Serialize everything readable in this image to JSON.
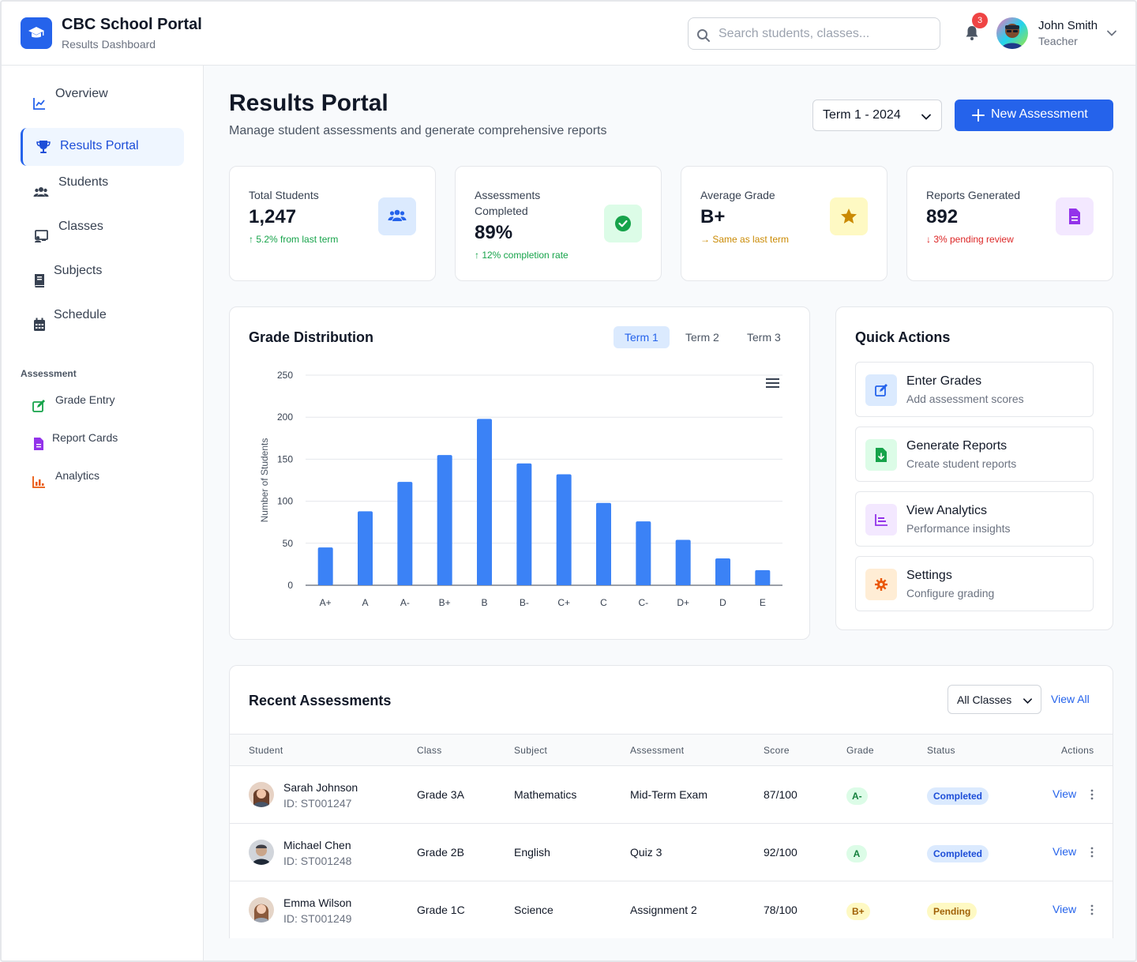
{
  "header": {
    "app_title": "CBC School Portal",
    "app_subtitle": "Results Dashboard",
    "search_placeholder": "Search students, classes...",
    "notification_count": "3",
    "user_name": "John Smith",
    "user_role": "Teacher"
  },
  "sidebar": {
    "items": [
      {
        "label": "Overview",
        "icon": "chart-line-icon"
      },
      {
        "label": "Results Portal",
        "icon": "trophy-icon",
        "active": true
      },
      {
        "label": "Students",
        "icon": "users-icon"
      },
      {
        "label": "Classes",
        "icon": "chalkboard-icon"
      },
      {
        "label": "Subjects",
        "icon": "book-icon"
      },
      {
        "label": "Schedule",
        "icon": "calendar-icon"
      }
    ],
    "section_label": "Assessment",
    "sub_items": [
      {
        "label": "Grade Entry",
        "icon": "edit-icon",
        "color": "#16a34a"
      },
      {
        "label": "Report Cards",
        "icon": "file-icon",
        "color": "#9333ea"
      },
      {
        "label": "Analytics",
        "icon": "bar-chart-icon",
        "color": "#ea580c"
      }
    ]
  },
  "page": {
    "title": "Results Portal",
    "subtitle": "Manage student assessments and generate comprehensive reports",
    "term_selected": "Term 1 - 2024",
    "new_button": "New Assessment"
  },
  "stats": [
    {
      "label": "Total Students",
      "value": "1,247",
      "note": "↑ 5.2% from last term",
      "note_color": "#16a34a",
      "icon": "users-icon",
      "icon_bg": "#dbeafe",
      "icon_color": "#2563eb"
    },
    {
      "label": "Assessments Completed",
      "value": "89%",
      "note": "↑ 12% completion rate",
      "note_color": "#16a34a",
      "icon": "check-circle-icon",
      "icon_bg": "#dcfce7",
      "icon_color": "#16a34a"
    },
    {
      "label": "Average Grade",
      "value": "B+",
      "note": "→ Same as last term",
      "note_color": "#ca8a04",
      "icon": "star-icon",
      "icon_bg": "#fef9c3",
      "icon_color": "#ca8a04"
    },
    {
      "label": "Reports Generated",
      "value": "892",
      "note": "↓ 3% pending review",
      "note_color": "#dc2626",
      "icon": "file-icon",
      "icon_bg": "#f3e8ff",
      "icon_color": "#9333ea"
    }
  ],
  "grade_distribution": {
    "title": "Grade Distribution",
    "tabs": [
      "Term 1",
      "Term 2",
      "Term 3"
    ],
    "active_tab": "Term 1"
  },
  "chart_data": {
    "type": "bar",
    "categories": [
      "A+",
      "A",
      "A-",
      "B+",
      "B",
      "B-",
      "C+",
      "C",
      "C-",
      "D+",
      "D",
      "E"
    ],
    "values": [
      45,
      88,
      123,
      155,
      198,
      145,
      132,
      98,
      76,
      54,
      32,
      18
    ],
    "xlabel": "",
    "ylabel": "Number of Students",
    "ylim": [
      0,
      250
    ],
    "yticks": [
      0,
      50,
      100,
      150,
      200,
      250
    ],
    "color": "#3b82f6",
    "grid": true
  },
  "quick_actions": {
    "title": "Quick Actions",
    "items": [
      {
        "name": "Enter Grades",
        "desc": "Add assessment scores",
        "icon": "edit-icon",
        "bg": "#dbeafe",
        "color": "#2563eb"
      },
      {
        "name": "Generate Reports",
        "desc": "Create student reports",
        "icon": "file-download-icon",
        "bg": "#dcfce7",
        "color": "#16a34a"
      },
      {
        "name": "View Analytics",
        "desc": "Performance insights",
        "icon": "bar-chart-icon",
        "bg": "#f3e8ff",
        "color": "#9333ea"
      },
      {
        "name": "Settings",
        "desc": "Configure grading",
        "icon": "gear-icon",
        "bg": "#ffedd5",
        "color": "#ea580c"
      }
    ]
  },
  "recent": {
    "title": "Recent Assessments",
    "filter": "All Classes",
    "view_all": "View All",
    "columns": [
      "Student",
      "Class",
      "Subject",
      "Assessment",
      "Score",
      "Grade",
      "Status",
      "Actions"
    ],
    "rows": [
      {
        "name": "Sarah Johnson",
        "id": "ID: ST001247",
        "class": "Grade 3A",
        "subject": "Mathematics",
        "assessment": "Mid-Term Exam",
        "score": "87/100",
        "grade": "A-",
        "status": "Completed",
        "action": "View"
      },
      {
        "name": "Michael Chen",
        "id": "ID: ST001248",
        "class": "Grade 2B",
        "subject": "English",
        "assessment": "Quiz 3",
        "score": "92/100",
        "grade": "A",
        "status": "Completed",
        "action": "View"
      },
      {
        "name": "Emma Wilson",
        "id": "ID: ST001249",
        "class": "Grade 1C",
        "subject": "Science",
        "assessment": "Assignment 2",
        "score": "78/100",
        "grade": "B+",
        "status": "Pending",
        "action": "View"
      }
    ]
  }
}
